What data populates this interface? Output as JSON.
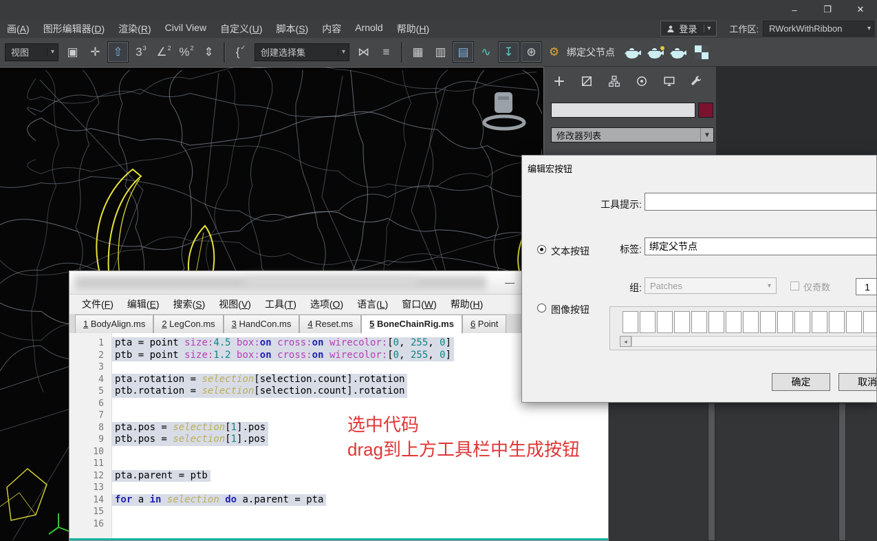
{
  "titlebar": {
    "minimize": "–",
    "maximize": "❐",
    "close": "✕"
  },
  "menubar": {
    "items": [
      "画(A)",
      "图形编辑器(D)",
      "渲染(R)",
      "Civil View",
      "自定义(U)",
      "脚本(S)",
      "内容",
      "Arnold",
      "帮助(H)"
    ],
    "login_label": "登录",
    "workspace_label": "工作区:",
    "workspace_value": "RWorkWithRibbon"
  },
  "toolbar": {
    "items": [
      {
        "t": "dd",
        "name": "view-dropdown",
        "text": "视图",
        "w": 78
      },
      {
        "t": "i",
        "name": "select-by-name-icon",
        "g": "▣"
      },
      {
        "t": "i",
        "name": "select-and-move-icon",
        "g": "✛"
      },
      {
        "t": "i",
        "name": "select-and-place-icon",
        "g": "⇧",
        "boxed": true,
        "c": "blue"
      },
      {
        "t": "i",
        "name": "snap-toggle-3d-icon",
        "g": "3",
        "sup": "3"
      },
      {
        "t": "i",
        "name": "angle-snap-icon",
        "g": "∠",
        "sup": "2"
      },
      {
        "t": "i",
        "name": "percent-snap-icon",
        "g": "%",
        "sup": "2"
      },
      {
        "t": "i",
        "name": "spinner-snap-icon",
        "g": "⇕"
      },
      {
        "t": "sep"
      },
      {
        "t": "i",
        "name": "macro-script-icon",
        "g": "{",
        "sup": "✓"
      },
      {
        "t": "dd",
        "name": "named-selection-set-dropdown",
        "text": "创建选择集",
        "w": 138
      },
      {
        "t": "i",
        "name": "mirror-icon",
        "g": "⋈"
      },
      {
        "t": "i",
        "name": "align-icon",
        "g": "≡"
      },
      {
        "t": "sep"
      },
      {
        "t": "i",
        "name": "scene-explorer-icon",
        "g": "▦"
      },
      {
        "t": "i",
        "name": "layer-manager-icon",
        "g": "▥"
      },
      {
        "t": "i",
        "name": "ribbon-toggle-icon",
        "g": "▤",
        "boxed": true,
        "c": "blue"
      },
      {
        "t": "i",
        "name": "curve-editor-icon",
        "g": "∿",
        "c": "teal"
      },
      {
        "t": "i",
        "name": "dope-sheet-icon",
        "g": "↧",
        "c": "teal",
        "boxed": true
      },
      {
        "t": "i",
        "name": "render-setup-icon",
        "g": "⊛",
        "boxed": true
      },
      {
        "t": "i",
        "name": "bind-parent-gear-icon",
        "g": "⚙",
        "c": "orange"
      },
      {
        "t": "label",
        "name": "bind-parent-label",
        "text": "绑定父节点"
      },
      {
        "t": "svg",
        "name": "render-frame-teapot-icon",
        "g": "teapot"
      },
      {
        "t": "svg",
        "name": "render-production-teapot-icon",
        "g": "teapot2"
      },
      {
        "t": "svg",
        "name": "render-iterative-teapot-icon",
        "g": "teapot"
      },
      {
        "t": "svg",
        "name": "state-sets-checker-icon",
        "g": "checker"
      }
    ]
  },
  "command_panel": {
    "tabs": [
      {
        "name": "tab-create",
        "icon": "plus"
      },
      {
        "name": "tab-modify",
        "icon": "shapes"
      },
      {
        "name": "tab-hierarchy",
        "icon": "hierarchy"
      },
      {
        "name": "tab-motion",
        "icon": "motion"
      },
      {
        "name": "tab-display",
        "icon": "display"
      },
      {
        "name": "tab-utilities",
        "icon": "wrench"
      }
    ],
    "name_field_value": "",
    "modifier_list": "修改器列表",
    "color_swatch": "#7a1230"
  },
  "dialog": {
    "title": "编辑宏按钮",
    "tooltip_label": "工具提示:",
    "tooltip_value": "",
    "text_radio_label": "文本按钮",
    "label_label": "标签:",
    "label_value": "绑定父节点",
    "group_label": "组:",
    "group_value": "Patches",
    "odd_label": "仅奇数",
    "count_value": "1",
    "image_radio_label": "图像按钮",
    "slot_count": 15,
    "ok_label": "确定",
    "cancel_label": "取消"
  },
  "script_editor": {
    "minimize": "—",
    "menu": [
      "文件(F)",
      "编辑(E)",
      "搜索(S)",
      "视图(V)",
      "工具(T)",
      "选项(O)",
      "语言(L)",
      "窗口(W)",
      "帮助(H)"
    ],
    "tabs": [
      {
        "num": "1",
        "file": "BodyAlign.ms",
        "active": false
      },
      {
        "num": "2",
        "file": "LegCon.ms",
        "active": false
      },
      {
        "num": "3",
        "file": "HandCon.ms",
        "active": false
      },
      {
        "num": "4",
        "file": "Reset.ms",
        "active": false
      },
      {
        "num": "5",
        "file": "BoneChainRig.ms",
        "active": true
      },
      {
        "num": "6",
        "file": "Point",
        "active": false
      }
    ],
    "lines": [
      {
        "n": 1,
        "sel": true,
        "seg": [
          [
            "d",
            "pta = point "
          ],
          [
            "a",
            "size:"
          ],
          [
            "n",
            "4.5"
          ],
          [
            "d",
            " "
          ],
          [
            "a",
            "box:"
          ],
          [
            "k",
            "on"
          ],
          [
            "d",
            " "
          ],
          [
            "a",
            "cross:"
          ],
          [
            "k",
            "on"
          ],
          [
            "d",
            " "
          ],
          [
            "a",
            "wirecolor:"
          ],
          [
            "d",
            "["
          ],
          [
            "n",
            "0"
          ],
          [
            "d",
            ", "
          ],
          [
            "n",
            "255"
          ],
          [
            "d",
            ", "
          ],
          [
            "n",
            "0"
          ],
          [
            "d",
            "]"
          ]
        ]
      },
      {
        "n": 2,
        "sel": true,
        "seg": [
          [
            "d",
            "ptb = point "
          ],
          [
            "a",
            "size:"
          ],
          [
            "n",
            "1.2"
          ],
          [
            "d",
            " "
          ],
          [
            "a",
            "box:"
          ],
          [
            "k",
            "on"
          ],
          [
            "d",
            " "
          ],
          [
            "a",
            "cross:"
          ],
          [
            "k",
            "on"
          ],
          [
            "d",
            " "
          ],
          [
            "a",
            "wirecolor:"
          ],
          [
            "d",
            "["
          ],
          [
            "n",
            "0"
          ],
          [
            "d",
            ", "
          ],
          [
            "n",
            "255"
          ],
          [
            "d",
            ", "
          ],
          [
            "n",
            "0"
          ],
          [
            "d",
            "]"
          ]
        ]
      },
      {
        "n": 3,
        "sel": false,
        "seg": []
      },
      {
        "n": 4,
        "sel": true,
        "seg": [
          [
            "d",
            "pta.rotation = "
          ],
          [
            "s",
            "selection"
          ],
          [
            "d",
            "[selection.count].rotation"
          ]
        ]
      },
      {
        "n": 5,
        "sel": true,
        "seg": [
          [
            "d",
            "ptb.rotation = "
          ],
          [
            "s",
            "selection"
          ],
          [
            "d",
            "[selection.count].rotation"
          ]
        ]
      },
      {
        "n": 6,
        "sel": false,
        "seg": []
      },
      {
        "n": 7,
        "sel": false,
        "seg": []
      },
      {
        "n": 8,
        "sel": true,
        "seg": [
          [
            "d",
            "pta.pos = "
          ],
          [
            "s",
            "selection"
          ],
          [
            "d",
            "["
          ],
          [
            "n",
            "1"
          ],
          [
            "d",
            "].pos"
          ]
        ]
      },
      {
        "n": 9,
        "sel": true,
        "seg": [
          [
            "d",
            "ptb.pos = "
          ],
          [
            "s",
            "selection"
          ],
          [
            "d",
            "["
          ],
          [
            "n",
            "1"
          ],
          [
            "d",
            "].pos"
          ]
        ]
      },
      {
        "n": 10,
        "sel": false,
        "seg": []
      },
      {
        "n": 11,
        "sel": false,
        "seg": []
      },
      {
        "n": 12,
        "sel": true,
        "seg": [
          [
            "d",
            "pta.parent = ptb"
          ]
        ]
      },
      {
        "n": 13,
        "sel": false,
        "seg": []
      },
      {
        "n": 14,
        "sel": true,
        "seg": [
          [
            "k",
            "for"
          ],
          [
            "d",
            " a "
          ],
          [
            "k",
            "in"
          ],
          [
            "d",
            " "
          ],
          [
            "s",
            "selection"
          ],
          [
            "d",
            " "
          ],
          [
            "k",
            "do"
          ],
          [
            "d",
            " a.parent = pta"
          ]
        ]
      },
      {
        "n": 15,
        "sel": false,
        "seg": []
      },
      {
        "n": 16,
        "sel": false,
        "seg": []
      }
    ]
  },
  "annotation": {
    "line1": "选中代码",
    "line2": "drag到上方工具栏中生成按钮"
  },
  "colors": {
    "wireframe": "#8d97a5",
    "selected_edges": "#f4ef3a",
    "annotation_red": "#e03636",
    "teal_accent": "#17b3a2",
    "swatch_maroon": "#7a1230",
    "code_selection_bg": "#d7dce6"
  }
}
